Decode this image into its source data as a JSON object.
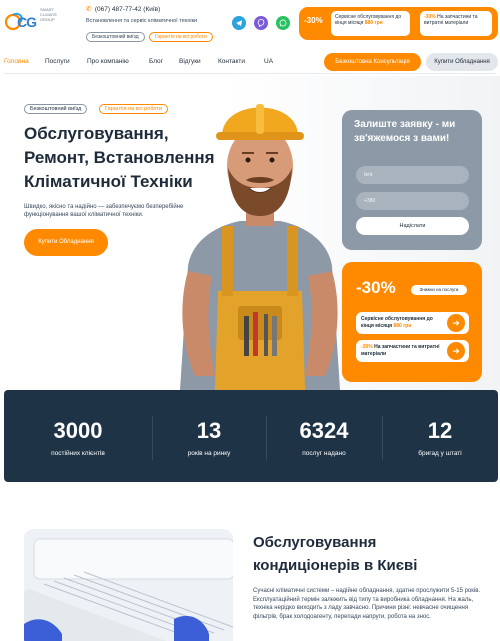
{
  "header": {
    "phone": "(067) 487-77-42 (Київ)",
    "tagline": "Встановлення та сервіс кліматичної техніки",
    "logo_text": "SMART CLIMATE GROUP",
    "pill_free": "Безкоштовний виїзд",
    "pill_warranty": "Гарантія на всі роботи",
    "promo": {
      "pct": "-30%",
      "box1_text": "Сервісне обслуговування до кінця місяця",
      "box1_price": "880 грн",
      "box2_pct": "-30%",
      "box2_text": "На запчастини та витратні матеріали"
    }
  },
  "nav": {
    "items": [
      "Головна",
      "Послуги",
      "Про компанію",
      "Блог",
      "Відгуки",
      "Контакти",
      "UA"
    ],
    "consult_button": "Безкоштовна Консультація",
    "buy_button": "Купити Обладнання"
  },
  "hero": {
    "pill_free": "Безкоштовний виїзд",
    "pill_warranty": "Гарантія на всі роботи",
    "title": "Обслуговування, Ремонт, Встановлення Кліматичної Техніки",
    "subtitle": "Швидко, якісно та надійно — забезпечуємо безперебійне функціонування вашої кліматичної техніки.",
    "button": "Купити Обладнання"
  },
  "form": {
    "title": "Залиште заявку - ми зв'яжемося з вами!",
    "name_placeholder": "Ім'я",
    "phone_placeholder": "+380",
    "submit": "Надіслати"
  },
  "sale": {
    "pct": "-30%",
    "badge": "Знижки на послуги",
    "row1_text": "Сервісне обслуговування до кінця місяця",
    "row1_price": "880 грн",
    "row2_pct": "-30%",
    "row2_text": "На запчастини та витратні матеріали"
  },
  "stats": [
    {
      "value": "3000",
      "label": "постійних клієнтів"
    },
    {
      "value": "13",
      "label": "років на ринку"
    },
    {
      "value": "6324",
      "label": "послуг надано"
    },
    {
      "value": "12",
      "label": "бригад у штаті"
    }
  ],
  "section": {
    "title": "Обслуговування кондиціонерів в Києві",
    "text": "Сучасні кліматичні системи – надійне обладнання, здатне прослужити 5-15 років. Експлуатаційний термін залежить від типу та виробника обладнання. На жаль, техніка нерідко виходить з ладу завчасно. Причини різні: невчасне очищення фільтрів, брак холодоагенту, перепади напруги, робота на знос."
  },
  "colors": {
    "accent": "#ff8a00",
    "dark": "#1f3346",
    "form_bg": "#8c9aa7"
  }
}
